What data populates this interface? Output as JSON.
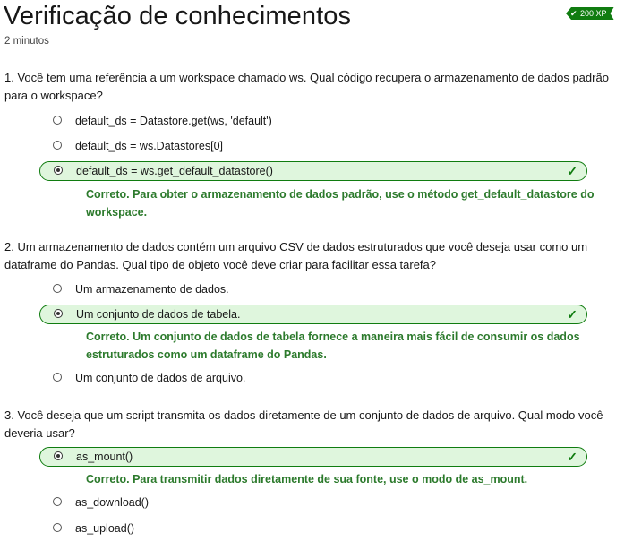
{
  "header": {
    "title": "Verificação de conhecimentos",
    "duration": "2 minutos",
    "xp_badge": "200 XP"
  },
  "questions": [
    {
      "text": "1. Você tem uma referência a um workspace chamado ws. Qual código recupera o armazenamento de dados padrão para o workspace?",
      "options": [
        "default_ds = Datastore.get(ws, 'default')",
        "default_ds = ws.Datastores[0]",
        "default_ds = ws.get_default_datastore()"
      ],
      "selected_index": 2,
      "feedback": "Correto. Para obter o armazenamento de dados padrão, use o método get_default_datastore do workspace."
    },
    {
      "text": "2. Um armazenamento de dados contém um arquivo CSV de dados estruturados que você deseja usar como um dataframe do Pandas. Qual tipo de objeto você deve criar para facilitar essa tarefa?",
      "options": [
        "Um armazenamento de dados.",
        "Um conjunto de dados de tabela.",
        "Um conjunto de dados de arquivo."
      ],
      "selected_index": 1,
      "feedback": "Correto. Um conjunto de dados de tabela fornece a maneira mais fácil de consumir os dados estruturados como um dataframe do Pandas."
    },
    {
      "text": "3. Você deseja que um script transmita os dados diretamente de um conjunto de dados de arquivo. Qual modo você deveria usar?",
      "options": [
        "as_mount()",
        "as_download()",
        "as_upload()"
      ],
      "selected_index": 0,
      "feedback": "Correto. Para transmitir dados diretamente de sua fonte, use o modo de as_mount."
    }
  ],
  "colors": {
    "correct_bg": "#dff6dd",
    "correct_border": "#107c10",
    "feedback_text": "#2c7a2c",
    "badge_bg": "#107c10"
  }
}
